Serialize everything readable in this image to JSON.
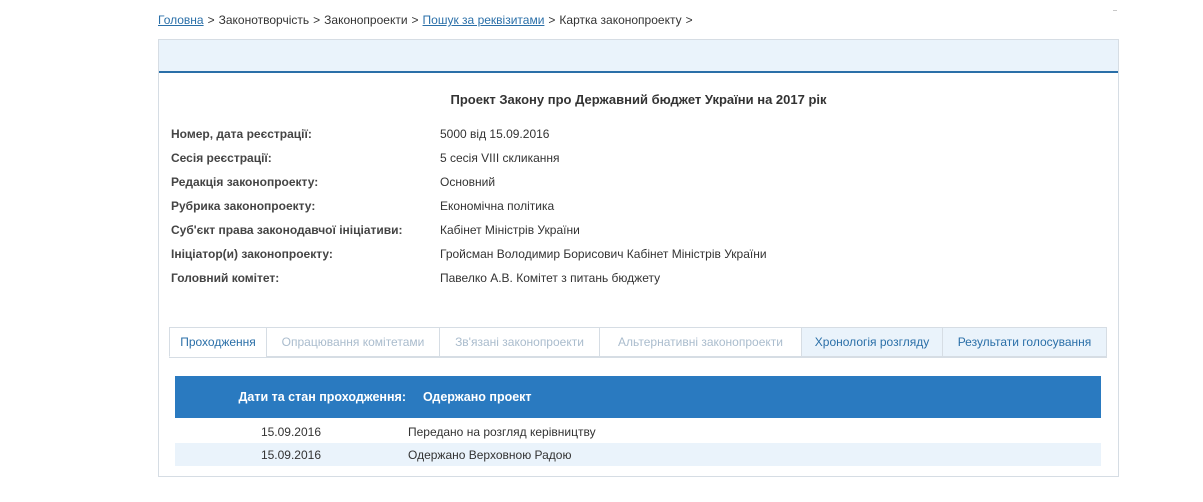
{
  "breadcrumb": {
    "home": "Головна",
    "lawmaking": "Законотворчість",
    "bills": "Законопроекти",
    "search": "Пошук за реквізитами",
    "card": "Картка законопроекту",
    "sep": ">"
  },
  "bill": {
    "title": "Проект Закону про Державний бюджет України на 2017 рік",
    "info": [
      {
        "label": "Номер, дата реєстрації:",
        "value": "5000 від 15.09.2016"
      },
      {
        "label": "Сесія реєстрації:",
        "value": "5 сесія VIII скликання"
      },
      {
        "label": "Редакція законопроекту:",
        "value": "Основний"
      },
      {
        "label": "Рубрика законопроекту:",
        "value": "Економічна політика"
      },
      {
        "label": "Суб'єкт права законодавчої ініціативи:",
        "value": "Кабінет Міністрів України"
      },
      {
        "label": "Ініціатор(и) законопроекту:",
        "value": "Гройсман Володимир Борисович Кабінет Міністрів України"
      },
      {
        "label": "Головний комітет:",
        "value": "Павелко А.В. Комітет з питань бюджету"
      }
    ]
  },
  "tabs": [
    {
      "label": "Проходження",
      "state": "active"
    },
    {
      "label": "Опрацювання комітетами",
      "state": "disabled"
    },
    {
      "label": "Зв'язані законопроекти",
      "state": "disabled"
    },
    {
      "label": "Альтернативні законопроекти",
      "state": "disabled"
    },
    {
      "label": "Хронологія розгляду",
      "state": "enabled"
    },
    {
      "label": "Результати голосування",
      "state": "enabled"
    }
  ],
  "passage": {
    "header_label": "Дати та стан проходження:",
    "header_status": "Одержано проект",
    "rows": [
      {
        "date": "15.09.2016",
        "status": "Передано на розгляд керівництву"
      },
      {
        "date": "15.09.2016",
        "status": "Одержано Верховною Радою"
      }
    ]
  },
  "colors": {
    "accent": "#2a7ac0",
    "link": "#2a6fa8",
    "light_bg": "#eaf3fb"
  }
}
